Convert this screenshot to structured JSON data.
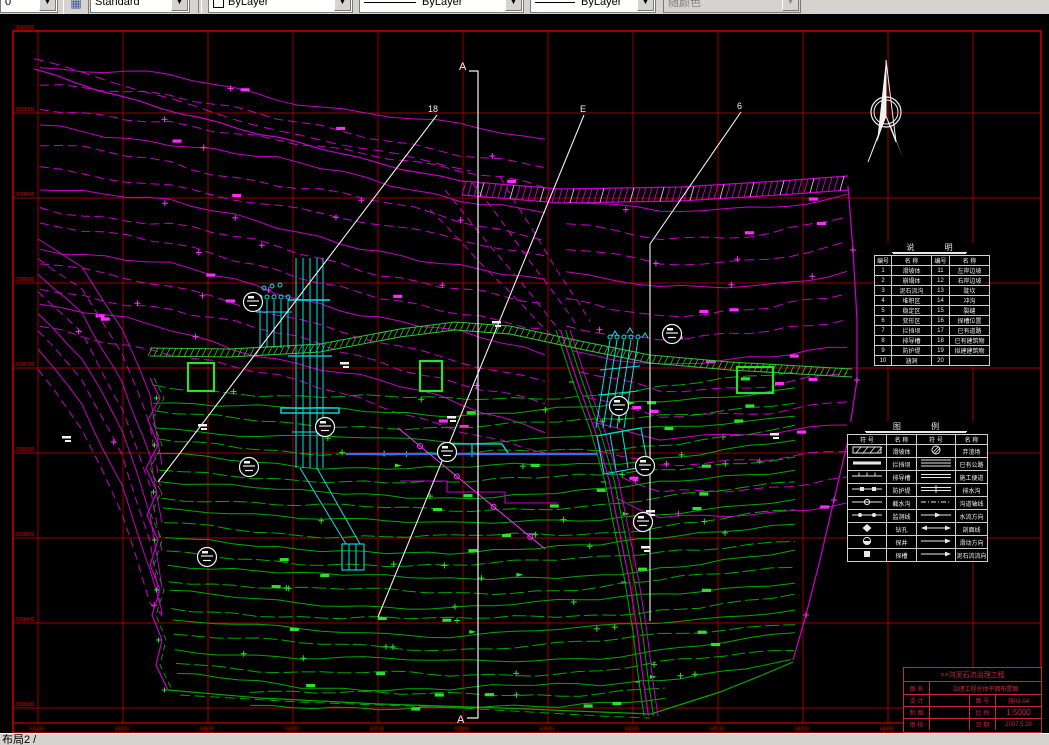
{
  "toolbar": {
    "layer_combo": {
      "value": "0"
    },
    "style_combo": {
      "value": "Standard"
    },
    "color_combo": {
      "value": "ByLayer"
    },
    "linetype_combo": {
      "value": "ByLayer"
    },
    "lineweight_combo": {
      "value": "ByLayer"
    },
    "plotstyle_combo": {
      "value": "随颜色"
    }
  },
  "status_bar": {
    "text": "布局2 /"
  },
  "icons": {
    "toolbar_button": "grid-icon",
    "combo_arrow": "chevron-down-icon",
    "compass": "north-arrow"
  },
  "colors": {
    "contour_upper": "#c400c4",
    "contour_upper_bright": "#ff2cff",
    "contour_lower": "#00a800",
    "contour_lower_bright": "#2ae22a",
    "road_green": "#35c035",
    "structure_cyan": "#00e5e5",
    "pipe_blue": "#2f6fff",
    "grid_red": "#9c0000",
    "frame_red": "#c40000",
    "label_red": "#e00000",
    "annotation_white": "#f2f2f2",
    "title_block_red": "#c8233f"
  },
  "drawing": {
    "section_labels": {
      "a_top": "A",
      "a_bottom": "A",
      "m18": "18",
      "mE": "E",
      "m6": "6"
    },
    "grid_labels_left": [
      "3299100",
      "3299000",
      "3298900",
      "3298800",
      "3298700",
      "3298600",
      "3298500",
      "3298400",
      "3298300"
    ],
    "grid_labels_bottom": [
      "63300",
      "63400",
      "63500",
      "63600",
      "63700",
      "63800",
      "63900",
      "64000",
      "64100",
      "64200",
      "64300",
      "64400"
    ],
    "legend_numbered": {
      "title": "说 明",
      "headers": [
        "编号",
        "名 称",
        "编号",
        "名 称"
      ],
      "rows": [
        [
          "1",
          "滑坡体",
          "11",
          "左岸边坡"
        ],
        [
          "2",
          "崩塌体",
          "12",
          "右岸边坡"
        ],
        [
          "3",
          "泥石流沟",
          "13",
          "陡坎"
        ],
        [
          "4",
          "堆积区",
          "14",
          "冲沟"
        ],
        [
          "5",
          "稳定区",
          "15",
          "裂缝"
        ],
        [
          "6",
          "变形区",
          "16",
          "探槽位置"
        ],
        [
          "7",
          "拦挡坝",
          "17",
          "已有道路"
        ],
        [
          "8",
          "排导槽",
          "18",
          "已有建筑物"
        ],
        [
          "9",
          "防护堤",
          "19",
          "拟建建筑物"
        ],
        [
          "10",
          "涵洞",
          "20",
          ""
        ]
      ]
    },
    "legend_symbols": {
      "title": "图 例",
      "headers": [
        "符 号",
        "名 称",
        "符 号",
        "名 称"
      ],
      "rows": [
        {
          "s1": "hatch-rect",
          "n1": "滑坡体",
          "s2": "hatch-circle",
          "n2": "弃渣场"
        },
        {
          "s1": "thick-line",
          "n1": "拦挡坝",
          "s2": "triple-line",
          "n2": "已有公路"
        },
        {
          "s1": "tick-line",
          "n1": "排导槽",
          "s2": "double-line",
          "n2": "施工便道"
        },
        {
          "s1": "square-line",
          "n1": "防护堤",
          "s2": "mid-tick-line",
          "n2": "排水沟"
        },
        {
          "s1": "circle-line",
          "n1": "截水沟",
          "s2": "dashdot-line",
          "n2": "沟道轴线"
        },
        {
          "s1": "node-line",
          "n1": "监测线",
          "s2": "mid-arrow-line",
          "n2": "水流方向"
        },
        {
          "s1": "diamond",
          "n1": "钻孔",
          "s2": "double-arrow-line",
          "n2": "剖面线"
        },
        {
          "s1": "half-circle",
          "n1": "探井",
          "s2": "arrow-line",
          "n2": "滑动方向"
        },
        {
          "s1": "square",
          "n1": "探槽",
          "s2": "arrow-line",
          "n2": "泥石流流向"
        }
      ]
    },
    "title_block": {
      "project": "××沟泥石流治理工程",
      "name_label": "图 名",
      "drawing_name": "治理工程总体平面布置图",
      "rows": [
        [
          "设 计",
          "",
          "图 号",
          "施03-04"
        ],
        [
          "制 图",
          "",
          "比 例",
          "1:5000"
        ],
        [
          "审 核",
          "",
          "日 期",
          "2007.5.28"
        ]
      ]
    }
  }
}
